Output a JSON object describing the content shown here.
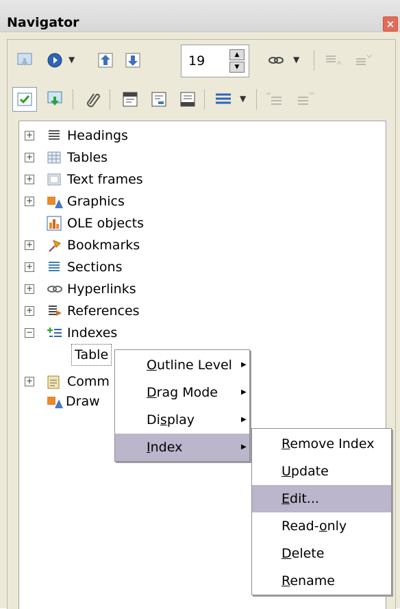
{
  "window": {
    "title": "Navigator",
    "close_glyph": "×"
  },
  "toolbar": {
    "page_number": "19",
    "row1_icons": [
      "navigation-icon",
      "previous-next-icon",
      "previous-icon",
      "next-icon",
      "hyperlink-icon",
      "promote-level-icon",
      "demote-level-icon"
    ],
    "row2_icons": [
      "content-view-icon",
      "set-reminder-icon",
      "paperclip-icon",
      "header-icon",
      "footer-icon",
      "anchor-text-icon",
      "heading-levels-icon",
      "promote-chapter-icon",
      "demote-chapter-icon"
    ]
  },
  "tree": {
    "items": [
      {
        "label": "Headings",
        "expander": "+",
        "icon": "headings-icon"
      },
      {
        "label": "Tables",
        "expander": "+",
        "icon": "tables-icon"
      },
      {
        "label": "Text frames",
        "expander": "+",
        "icon": "text-frames-icon"
      },
      {
        "label": "Graphics",
        "expander": "+",
        "icon": "graphics-icon"
      },
      {
        "label": "OLE objects",
        "expander": "",
        "icon": "ole-objects-icon"
      },
      {
        "label": "Bookmarks",
        "expander": "+",
        "icon": "bookmarks-icon"
      },
      {
        "label": "Sections",
        "expander": "+",
        "icon": "sections-icon"
      },
      {
        "label": "Hyperlinks",
        "expander": "+",
        "icon": "hyperlinks-icon"
      },
      {
        "label": "References",
        "expander": "+",
        "icon": "references-icon"
      },
      {
        "label": "Indexes",
        "expander": "−",
        "icon": "indexes-icon"
      }
    ],
    "child_index": "Table",
    "comments_partial": "Comm",
    "draw_partial": "Draw"
  },
  "context_menu": {
    "items": [
      {
        "label": "Outline Level",
        "underline": 0,
        "has_submenu": true
      },
      {
        "label": "Drag Mode",
        "underline": 0,
        "has_submenu": true
      },
      {
        "label": "Display",
        "underline": 2,
        "has_submenu": true
      },
      {
        "label": "Index",
        "underline": 0,
        "has_submenu": true,
        "highlighted": true
      }
    ]
  },
  "submenu": {
    "items": [
      {
        "label": "Remove Index",
        "underline": 0
      },
      {
        "label": "Update",
        "underline": 0
      },
      {
        "label": "Edit...",
        "underline": 0,
        "highlighted": true
      },
      {
        "label": "Read-only",
        "underline": 5
      },
      {
        "label": "Delete",
        "underline": 0
      },
      {
        "label": "Rename",
        "underline": 0
      }
    ]
  },
  "colors": {
    "menu_highlight": "#bbb6cb",
    "panel_bg": "#ece9d8",
    "close_bg": "#e46b58"
  }
}
